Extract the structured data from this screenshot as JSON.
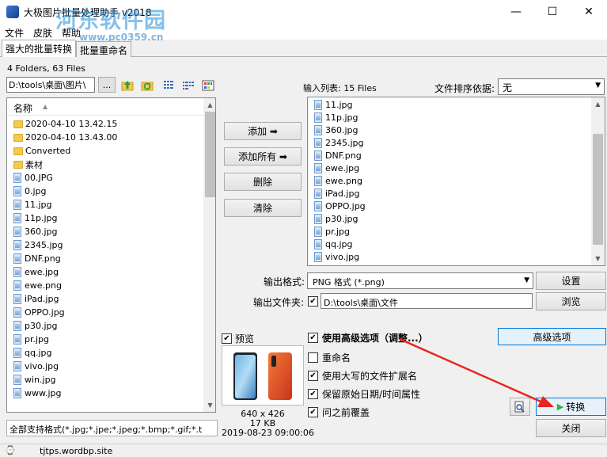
{
  "window": {
    "title": "大极图片批量处理助手 v2018",
    "minimize_glyph": "—",
    "maximize_glyph": "☐",
    "close_glyph": "✕"
  },
  "watermark": {
    "name": "河东软件园",
    "url": "www.pc0359.cn"
  },
  "menu": [
    "文件",
    "皮肤",
    "帮助"
  ],
  "tabs": [
    {
      "label": "强大的批量转换",
      "active": true
    },
    {
      "label": "批量重命名",
      "active": false
    }
  ],
  "left": {
    "folder_count": "4 Folders, 63 Files",
    "path": "D:\\tools\\桌面\\图片\\",
    "browse_label": "...",
    "column_header": "名称",
    "sort_glyph": "▲",
    "folders": [
      "2020-04-10 13.42.15",
      "2020-04-10 13.43.00",
      "Converted",
      "素材"
    ],
    "files": [
      "00.JPG",
      "0.jpg",
      "11.jpg",
      "11p.jpg",
      "360.jpg",
      "2345.jpg",
      "DNF.png",
      "ewe.jpg",
      "ewe.png",
      "iPad.jpg",
      "OPPO.jpg",
      "p30.jpg",
      "pr.jpg",
      "qq.jpg",
      "vivo.jpg",
      "win.jpg",
      "www.jpg"
    ],
    "filter": "全部支持格式(*.jpg;*.jpe;*.jpeg;*.bmp;*.gif;*.t"
  },
  "middle_buttons": {
    "add": "添加 ➡",
    "add_all": "添加所有 ➡",
    "delete": "删除",
    "clear": "清除"
  },
  "input_list": {
    "label": "输入列表:  15 Files",
    "sort_label": "文件排序依据:",
    "sort_value": "无",
    "items": [
      "11.jpg",
      "11p.jpg",
      "360.jpg",
      "2345.jpg",
      "DNF.png",
      "ewe.jpg",
      "ewe.png",
      "iPad.jpg",
      "OPPO.jpg",
      "p30.jpg",
      "pr.jpg",
      "qq.jpg",
      "vivo.jpg"
    ]
  },
  "output": {
    "format_label": "输出格式:",
    "format_value": "PNG 格式  (*.png)",
    "settings_button": "设置",
    "folder_label": "输出文件夹:",
    "folder_value": "D:\\tools\\桌面\\文件",
    "browse_button": "浏览"
  },
  "preview": {
    "label": "预览",
    "dimensions": "640 x 426",
    "size": "17 KB",
    "date": "2019-08-23 09:00:06"
  },
  "options": {
    "advanced": "使用高级选项（调整...）",
    "rename": "重命名",
    "uppercase_ext": "使用大写的文件扩展名",
    "keep_date": "保留原始日期/时间属性",
    "overwrite": "问之前覆盖",
    "advanced_button": "高级选项"
  },
  "actions": {
    "convert": "转换",
    "close": "关闭"
  },
  "status": {
    "text": "tjtps.wordbp.site"
  },
  "colors": {
    "accent_blue": "#cce8ff",
    "arrow_red": "#e8261f",
    "convert_green": "#2fb344"
  }
}
